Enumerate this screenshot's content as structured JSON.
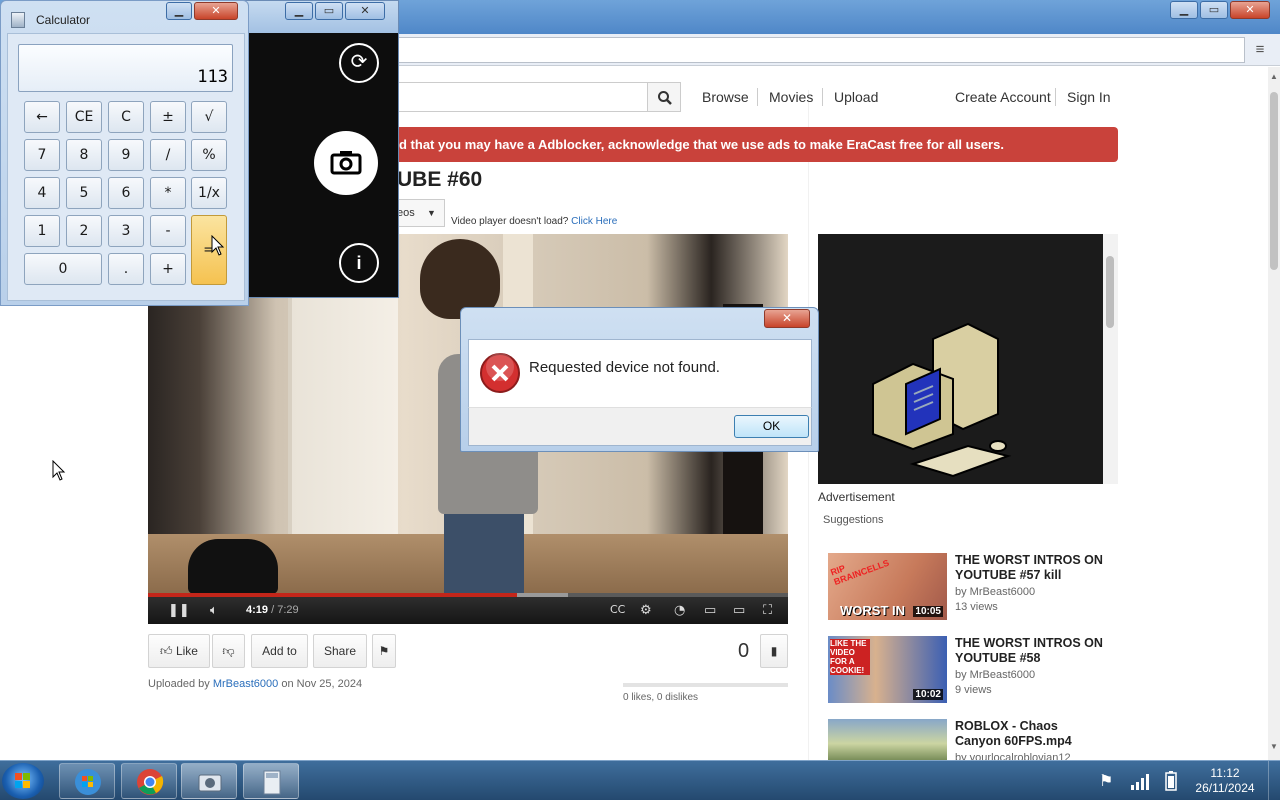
{
  "browser": {
    "nav": {
      "browse": "Browse",
      "movies": "Movies",
      "upload": "Upload",
      "create_account": "Create Account",
      "sign_in": "Sign In"
    },
    "ad_banner": "d that you may have a Adblocker, acknowledge that we use ads to make EraCast free for all users.",
    "video_title": "UBE #60",
    "dropdown_label": "eos",
    "player_note": "Video player doesn't load?",
    "player_note_link": "Click Here",
    "player": {
      "current_time": "4:19",
      "duration": "/ 7:29",
      "played_fraction": 0.577
    },
    "actions": {
      "like": "Like",
      "add_to": "Add to",
      "share": "Share"
    },
    "view_count": "0",
    "uploaded_prefix": "Uploaded by",
    "uploader": "MrBeast6000",
    "uploaded_date": "on Nov 25, 2024",
    "likes_summary": "0 likes, 0 dislikes",
    "advertisement_label": "Advertisement",
    "suggestions_label": "Suggestions",
    "suggestions": [
      {
        "title": "THE WORST INTROS ON YOUTUBE #57 kill",
        "by": "by MrBeast6000",
        "views": "13 views",
        "duration": "10:05",
        "thumb_caption": "WORST IN",
        "thumb_tag": "RIP BRAINCELLS"
      },
      {
        "title": "THE WORST INTROS ON YOUTUBE #58",
        "by": "by MrBeast6000",
        "views": "9 views",
        "duration": "10:02",
        "thumb_tag": "LIKE THE VIDEO FOR A COOKIE!"
      },
      {
        "title": "ROBLOX - Chaos Canyon 60FPS.mp4",
        "by": "by yourlocalroblovian12",
        "views": "",
        "duration": ""
      }
    ]
  },
  "calculator": {
    "title": "Calculator",
    "display": "113",
    "keys": [
      "←",
      "CE",
      "C",
      "±",
      "√",
      "7",
      "8",
      "9",
      "/",
      "%",
      "4",
      "5",
      "6",
      "*",
      "1/x",
      "1",
      "2",
      "3",
      "-",
      "=",
      "0",
      ".",
      "+"
    ]
  },
  "dialog": {
    "message": "Requested device not found.",
    "ok_label": "OK",
    "close_symbol": "✕"
  },
  "taskbar": {
    "time": "11:12",
    "date": "26/11/2024",
    "apps": [
      "windows-explorer",
      "chrome",
      "camera",
      "calculator"
    ]
  },
  "colors": {
    "ad_banner": "#c9423b",
    "error_red": "#d32f2f",
    "link": "#2a6ebb",
    "equals_key": "#f5c250"
  }
}
